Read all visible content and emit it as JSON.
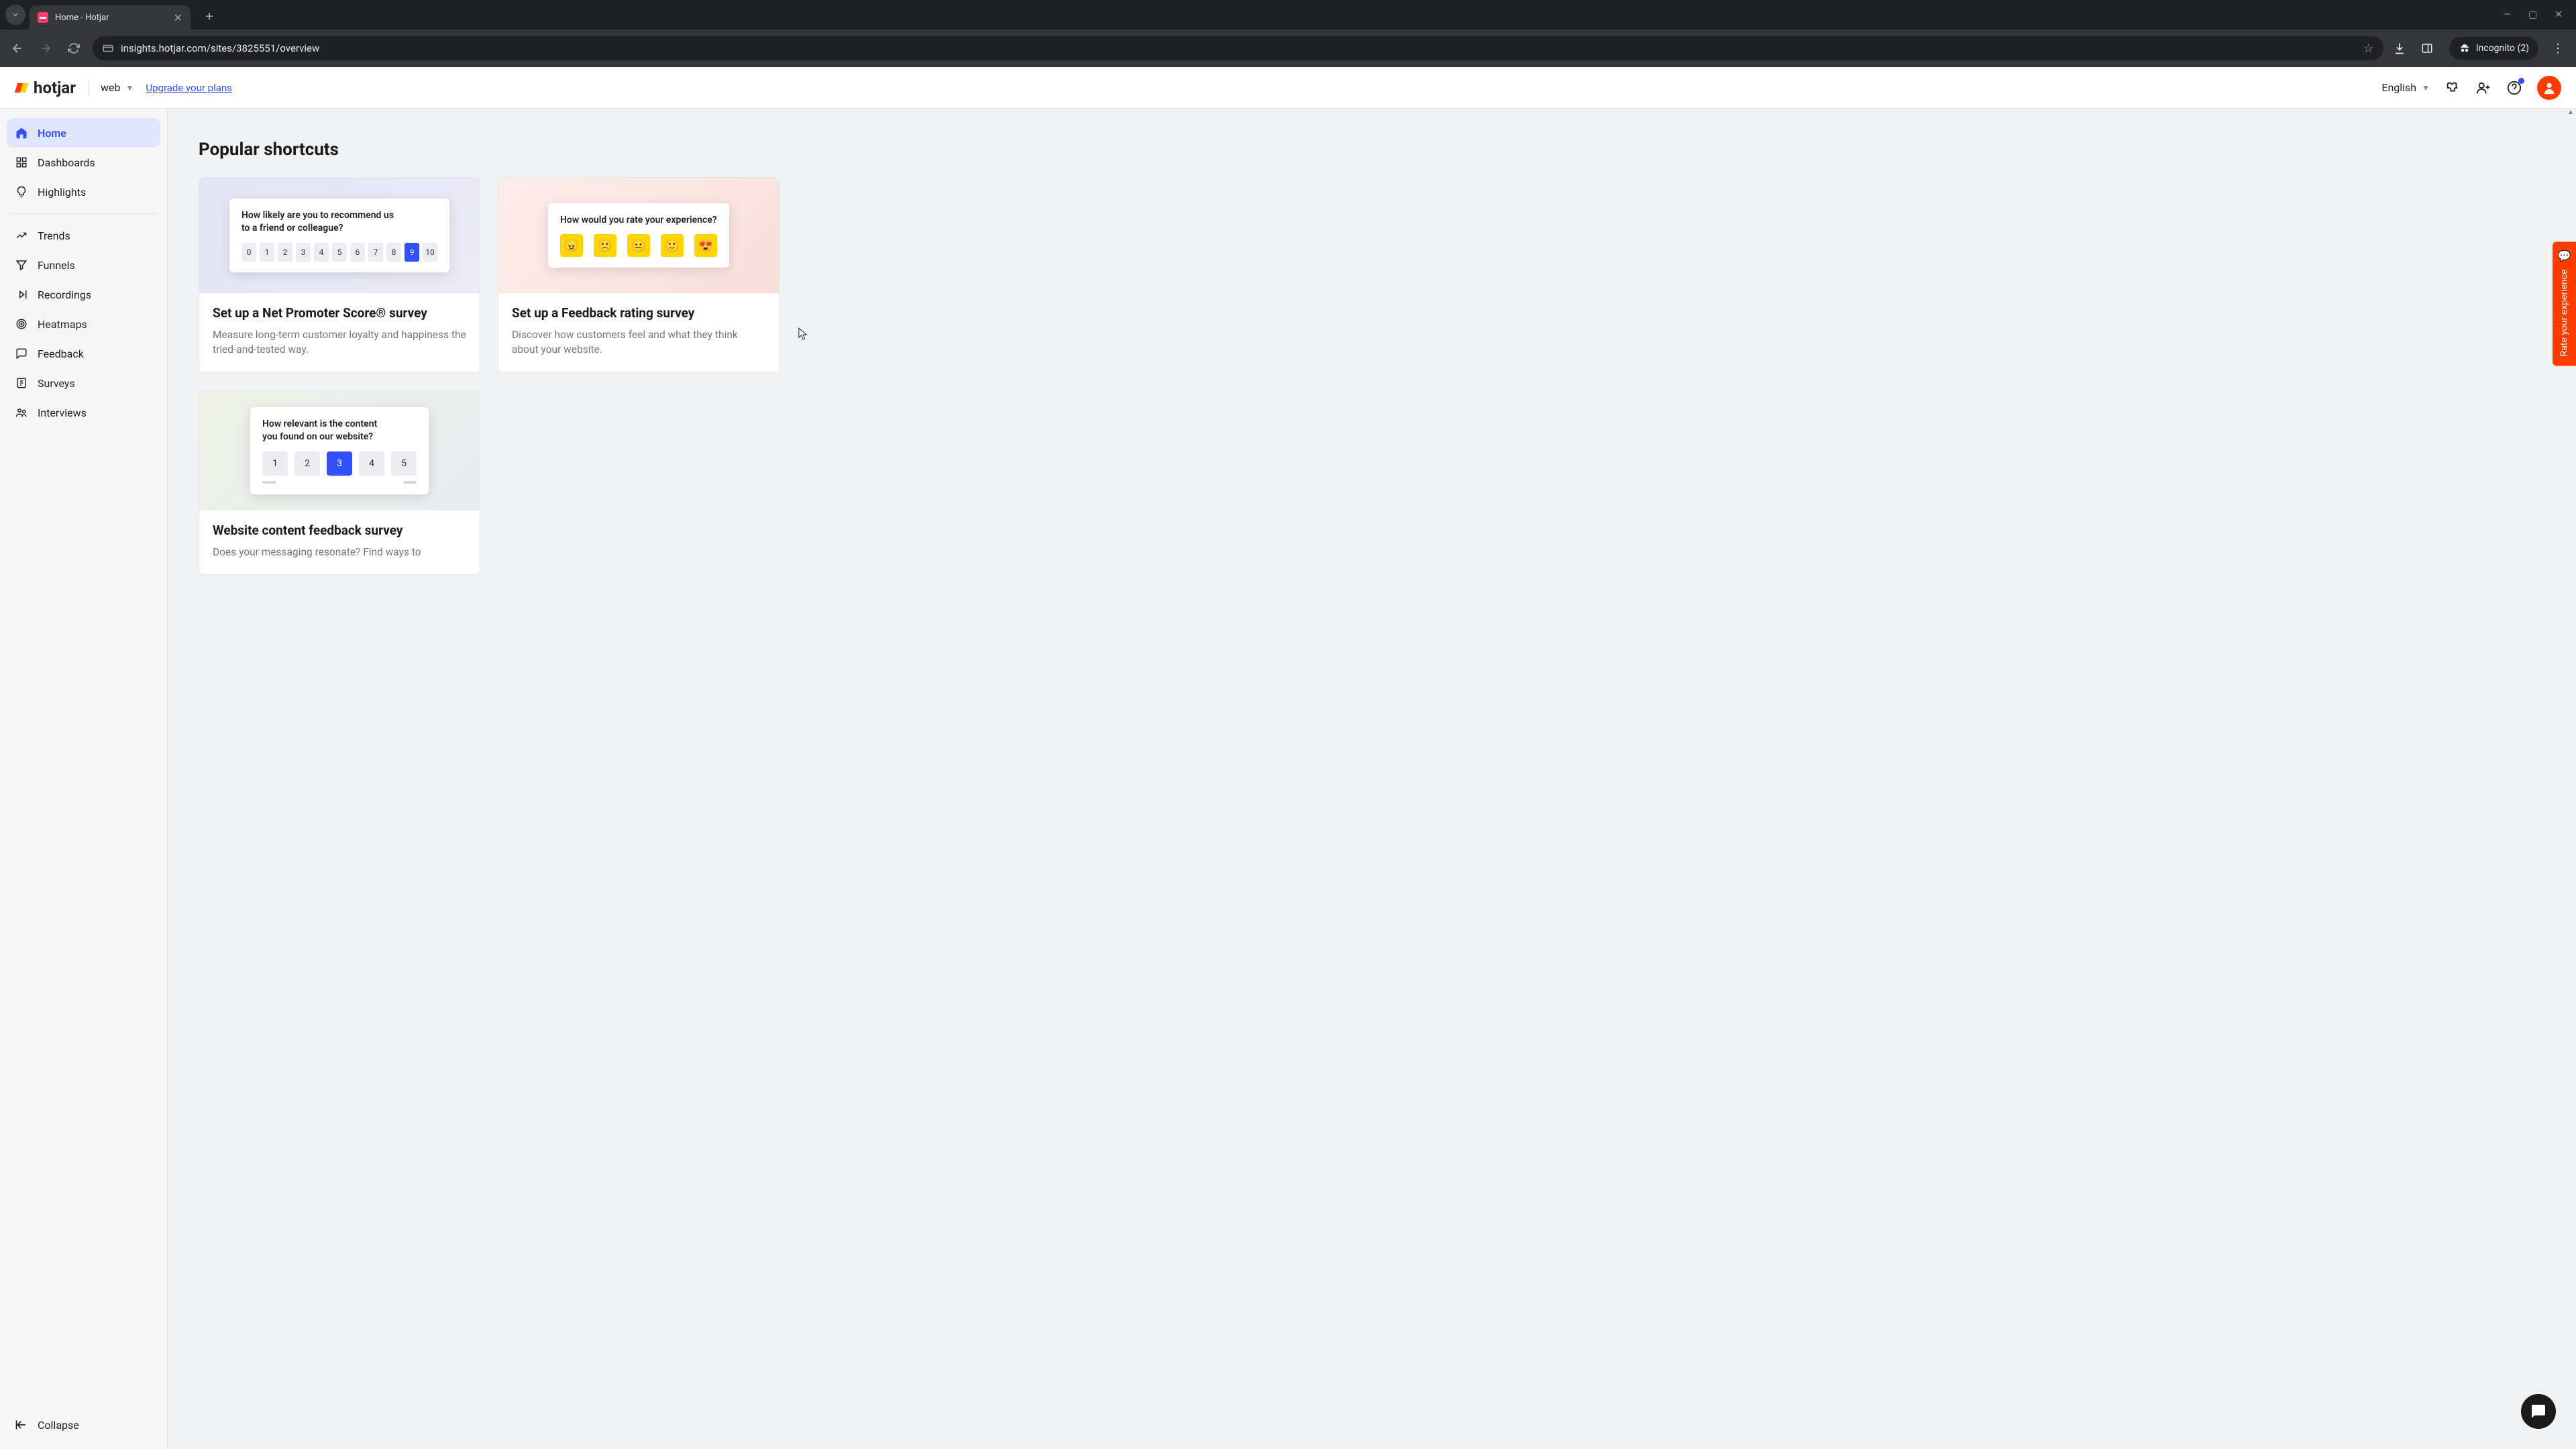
{
  "browser": {
    "tab_title": "Home - Hotjar",
    "url": "insights.hotjar.com/sites/3825551/overview",
    "incognito_label": "Incognito (2)"
  },
  "header": {
    "logo_text": "hotjar",
    "site_name": "web",
    "upgrade": "Upgrade your plans",
    "language": "English"
  },
  "sidebar": {
    "items": [
      {
        "label": "Home"
      },
      {
        "label": "Dashboards"
      },
      {
        "label": "Highlights"
      },
      {
        "label": "Trends"
      },
      {
        "label": "Funnels"
      },
      {
        "label": "Recordings"
      },
      {
        "label": "Heatmaps"
      },
      {
        "label": "Feedback"
      },
      {
        "label": "Surveys"
      },
      {
        "label": "Interviews"
      }
    ],
    "collapse": "Collapse"
  },
  "main": {
    "heading": "Popular shortcuts",
    "cards": {
      "nps": {
        "question": "How likely are you to recommend us to a friend or colleague?",
        "selected": "9",
        "title": "Set up a Net Promoter Score® survey",
        "desc": "Measure long-term customer loyalty and happiness the tried-and-tested way."
      },
      "rate": {
        "question": "How would you rate your experience?",
        "title": "Set up a Feedback rating survey",
        "desc": "Discover how customers feel and what they think about your website."
      },
      "content": {
        "question": "How relevant is the content you found on our website?",
        "selected": "3",
        "title": "Website content feedback survey",
        "desc": "Does your messaging resonate? Find ways to"
      }
    }
  },
  "side_tab": "Rate your experience",
  "nps_scale": [
    "0",
    "1",
    "2",
    "3",
    "4",
    "5",
    "6",
    "7",
    "8",
    "9",
    "10"
  ],
  "five_scale": [
    "1",
    "2",
    "3",
    "4",
    "5"
  ],
  "emojis": [
    "😠",
    "🙁",
    "😐",
    "🙂",
    "😍"
  ]
}
